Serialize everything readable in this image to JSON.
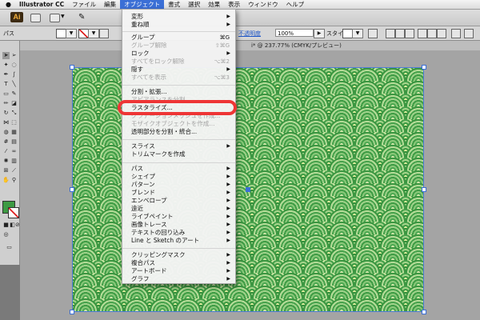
{
  "menubar": {
    "app_name": "Illustrator CC",
    "items": [
      "ファイル",
      "編集",
      "オブジェクト",
      "書式",
      "選択",
      "効果",
      "表示",
      "ウィンドウ",
      "ヘルプ"
    ]
  },
  "appbar": {
    "logo": "Ai"
  },
  "control_bar": {
    "path_label": "パス",
    "opacity_label": "不透明度",
    "opacity_value": "100%",
    "style_label": "スタイル :"
  },
  "document": {
    "tab_title": "i* @ 237.77% (CMYK/プレビュー)"
  },
  "object_menu": {
    "items": [
      {
        "label": "変形",
        "submenu": true
      },
      {
        "label": "重ね順",
        "submenu": true
      },
      {
        "label": "グループ",
        "shortcut": "⌘G"
      },
      {
        "label": "グループ解除",
        "shortcut": "⇧⌘G",
        "disabled": true
      },
      {
        "label": "ロック",
        "submenu": true
      },
      {
        "label": "すべてをロック解除",
        "shortcut": "⌥⌘2",
        "disabled": true
      },
      {
        "label": "隠す",
        "submenu": true
      },
      {
        "label": "すべてを表示",
        "shortcut": "⌥⌘3",
        "disabled": true
      },
      {
        "label": "分割・拡張..."
      },
      {
        "label": "アピアランスを分割",
        "disabled": true
      },
      {
        "label": "ラスタライズ..."
      },
      {
        "label": "グラデーションメッシュを作成...",
        "disabled": true
      },
      {
        "label": "モザイクオブジェクトを作成...",
        "disabled": true
      },
      {
        "label": "透明部分を分割・統合..."
      },
      {
        "label": "スライス",
        "submenu": true
      },
      {
        "label": "トリムマークを作成"
      },
      {
        "label": "パス",
        "submenu": true
      },
      {
        "label": "シェイプ",
        "submenu": true
      },
      {
        "label": "パターン",
        "submenu": true
      },
      {
        "label": "ブレンド",
        "submenu": true
      },
      {
        "label": "エンベロープ",
        "submenu": true
      },
      {
        "label": "遠近",
        "submenu": true
      },
      {
        "label": "ライブペイント",
        "submenu": true
      },
      {
        "label": "画像トレース",
        "submenu": true
      },
      {
        "label": "テキストの回り込み",
        "submenu": true
      },
      {
        "label": "Line と Sketch のアート",
        "submenu": true
      },
      {
        "label": "クリッピングマスク",
        "submenu": true
      },
      {
        "label": "複合パス",
        "submenu": true
      },
      {
        "label": "アートボード",
        "submenu": true
      },
      {
        "label": "グラフ",
        "submenu": true
      }
    ]
  },
  "colors": {
    "menu_highlight": "#3b6fd6",
    "annotation_ring": "#ee3535",
    "pattern_green": "#3d9a43"
  }
}
